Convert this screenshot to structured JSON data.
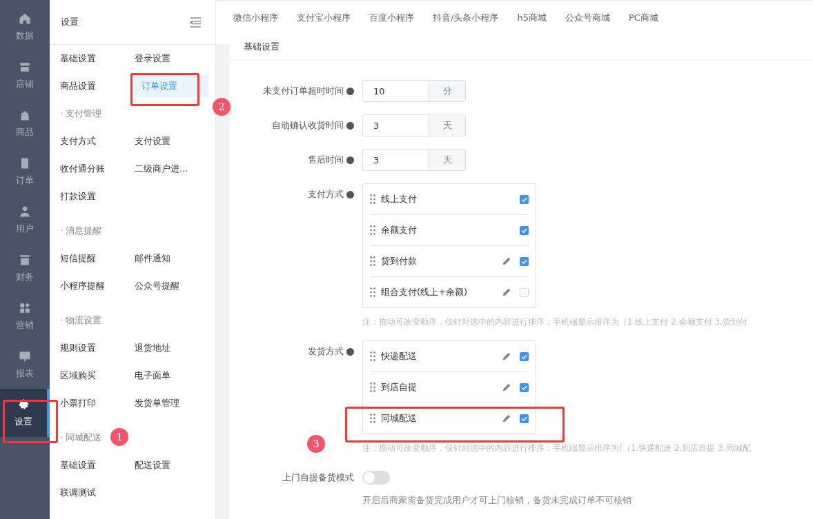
{
  "nav": [
    {
      "label": "数据",
      "selected": false
    },
    {
      "label": "店铺",
      "selected": false
    },
    {
      "label": "商品",
      "selected": false
    },
    {
      "label": "订单",
      "selected": false
    },
    {
      "label": "用户",
      "selected": false
    },
    {
      "label": "财务",
      "selected": false
    },
    {
      "label": "营销",
      "selected": false
    },
    {
      "label": "报表",
      "selected": false
    },
    {
      "label": "设置",
      "selected": true
    }
  ],
  "settings_panel": {
    "title": "设置",
    "groups": [
      {
        "items": [
          {
            "label": "基础设置",
            "selected": false
          },
          {
            "label": "登录设置",
            "selected": false
          },
          {
            "label": "商品设置",
            "selected": false
          },
          {
            "label": "订单设置",
            "selected": true
          }
        ]
      },
      {
        "heading": "· 支付管理",
        "items": [
          {
            "label": "支付方式",
            "selected": false
          },
          {
            "label": "支付设置",
            "selected": false
          },
          {
            "label": "收付通分账",
            "selected": false
          },
          {
            "label": "二级商户进...",
            "selected": false
          },
          {
            "label": "打款设置",
            "selected": false
          }
        ]
      },
      {
        "heading": "· 消息提醒",
        "items": [
          {
            "label": "短信提醒",
            "selected": false
          },
          {
            "label": "邮件通知",
            "selected": false
          },
          {
            "label": "小程序提醒",
            "selected": false
          },
          {
            "label": "公众号提醒",
            "selected": false
          }
        ]
      },
      {
        "heading": "· 物流设置",
        "items": [
          {
            "label": "规则设置",
            "selected": false
          },
          {
            "label": "退货地址",
            "selected": false
          },
          {
            "label": "区域购买",
            "selected": false
          },
          {
            "label": "电子面单",
            "selected": false
          },
          {
            "label": "小票打印",
            "selected": false
          },
          {
            "label": "发货单管理",
            "selected": false
          }
        ]
      },
      {
        "heading": "· 同城配送",
        "items": [
          {
            "label": "基础设置",
            "selected": false
          },
          {
            "label": "配送设置",
            "selected": false
          },
          {
            "label": "联调测试",
            "selected": false
          }
        ]
      }
    ]
  },
  "tabs": [
    "微信小程序",
    "支付宝小程序",
    "百度小程序",
    "抖音/头条小程序",
    "h5商城",
    "公众号商城",
    "PC商城"
  ],
  "section_title": "基础设置",
  "time_fields": [
    {
      "label": "未支付订单超时时间",
      "value": "10",
      "unit": "分"
    },
    {
      "label": "自动确认收货时间",
      "value": "3",
      "unit": "天"
    },
    {
      "label": "售后时间",
      "value": "3",
      "unit": "天"
    }
  ],
  "option_lists": [
    {
      "label": "支付方式",
      "options": [
        {
          "label": "线上支付",
          "editable": false,
          "checked": true
        },
        {
          "label": "余额支付",
          "editable": false,
          "checked": true
        },
        {
          "label": "货到付款",
          "editable": true,
          "checked": true
        },
        {
          "label": "组合支付(线上+余额)",
          "editable": true,
          "checked": false
        }
      ],
      "note": "注：拖动可改变顺序，仅针对选中的内容进行排序；手机端显示排序为（1.线上支付 2.余额支付 3.货到付"
    },
    {
      "label": "发货方式",
      "options": [
        {
          "label": "快递配送",
          "editable": true,
          "checked": true
        },
        {
          "label": "到店自提",
          "editable": true,
          "checked": true
        },
        {
          "label": "同城配送",
          "editable": true,
          "checked": true
        }
      ],
      "note": "注：拖动可改变顺序，仅针对选中的内容进行排序；手机端显示排序为(（1.快递配送 2.到店自提 3.同城配"
    }
  ],
  "pickup": {
    "label": "上门自提备货模式",
    "on": false,
    "hint": "开启后商家需备货完成用户才可上门核销，备货未完成订单不可核销"
  },
  "badges": [
    "1",
    "2",
    "3"
  ]
}
